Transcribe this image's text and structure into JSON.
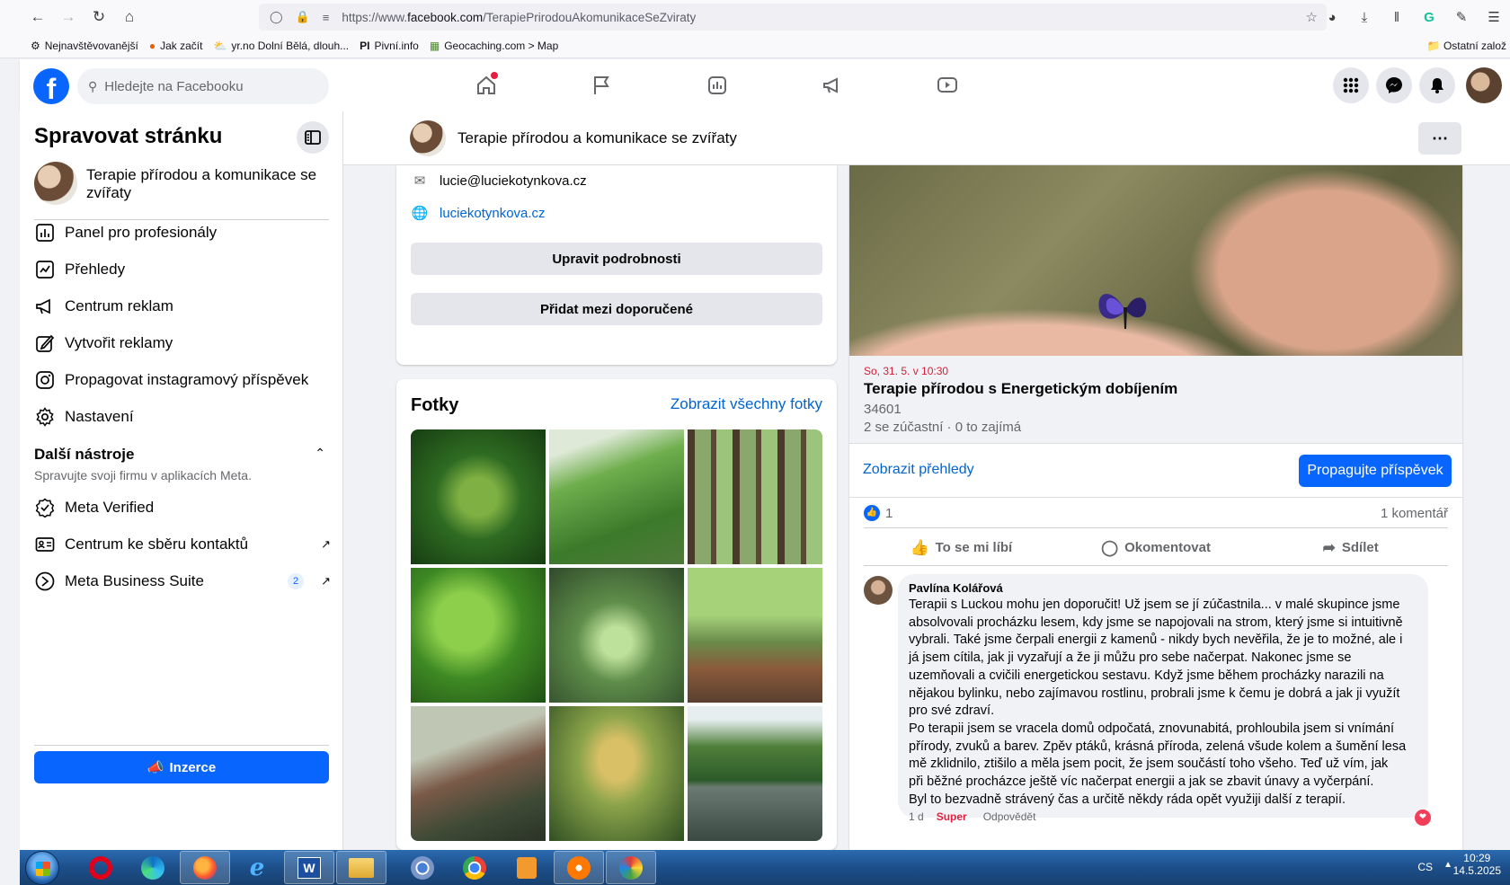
{
  "browser": {
    "url_prefix": "https://www.",
    "url_domain": "facebook.com",
    "url_path": "/TerapiePrirodouAkomunikaceSeZviraty",
    "bookmarks": [
      {
        "label": "Nejnavštěvovanější",
        "icon": "gear-icon"
      },
      {
        "label": "Jak začít",
        "icon": "firefox-icon"
      },
      {
        "label": "yr.no Dolní Bělá, dlouh...",
        "icon": "weather-icon"
      },
      {
        "label": "Pivní.info",
        "icon": "pi-icon"
      },
      {
        "label": "Geocaching.com > Map",
        "icon": "geocaching-icon"
      }
    ],
    "other_bookmarks": "Ostatní založ"
  },
  "fb": {
    "search_placeholder": "Hledejte na Facebooku"
  },
  "sidebar": {
    "title": "Spravovat stránku",
    "page_name": "Terapie přírodou a komunikace se zvířaty",
    "items": [
      {
        "label": "Panel pro profesionály",
        "icon": "dashboard-icon"
      },
      {
        "label": "Přehledy",
        "icon": "insights-icon"
      },
      {
        "label": "Centrum reklam",
        "icon": "megaphone-icon"
      },
      {
        "label": "Vytvořit reklamy",
        "icon": "pencil-icon"
      },
      {
        "label": "Propagovat instagramový příspěvek",
        "icon": "instagram-icon"
      },
      {
        "label": "Nastavení",
        "icon": "gear-icon"
      }
    ],
    "tools_title": "Další nástroje",
    "tools_subtitle": "Spravujte svoji firmu v aplikacích Meta.",
    "tools": [
      {
        "label": "Meta Verified",
        "icon": "verified-icon"
      },
      {
        "label": "Centrum ke sběru kontaktů",
        "icon": "contact-card-icon"
      },
      {
        "label": "Meta Business Suite",
        "icon": "meta-suite-icon",
        "badge": "2"
      }
    ],
    "ad_button": "Inzerce"
  },
  "page_header": {
    "name": "Terapie přírodou a komunikace se zvířaty"
  },
  "info": {
    "email": "lucie@luciekotynkova.cz",
    "website": "luciekotynkova.cz",
    "edit_button": "Upravit podrobnosti",
    "recommend_button": "Přidat mezi doporučené"
  },
  "photos": {
    "title": "Fotky",
    "view_all": "Zobrazit všechny fotky"
  },
  "post": {
    "event_date": "So, 31. 5. v 10:30",
    "event_title": "Terapie přírodou s Energetickým dobíjením",
    "event_location": "34601",
    "event_stats": "2 se zúčastní · 0 to zajímá",
    "insights_link": "Zobrazit přehledy",
    "boost_button": "Propagujte příspěvek",
    "like_count": "1",
    "comment_count": "1 komentář",
    "actions": {
      "like": "To se mi líbí",
      "comment": "Okomentovat",
      "share": "Sdílet"
    },
    "comment": {
      "author": "Pavlína Kolářová",
      "lines": [
        "Terapii s Luckou mohu jen doporučit! Už jsem se jí zúčastnila... v malé skupince jsme",
        "absolvovali procházku lesem, kdy jsme se napojovali na strom, který jsme si intuitivně",
        "vybrali. Také jsme čerpali energii z kamenů - nikdy bych nevěřila, že je to možné, ale i",
        "já jsem cítila, jak ji vyzařují a že ji můžu pro sebe načerpat. Nakonec jsme se",
        "uzemňovali a cvičili energetickou sestavu. Když jsme během procházky narazili na",
        "nějakou bylinku, nebo zajímavou rostlinu, probrali jsme k čemu je dobrá a jak ji využít",
        "pro své zdraví.",
        "Po terapii jsem se vracela domů odpočatá, znovunabitá, prohloubila jsem si vnímání",
        "přírody, zvuků a barev. Zpěv ptáků, krásná příroda, zelená všude kolem a šumění lesa",
        "mě zklidnilo, ztišilo a měla jsem pocit, že jsem součástí toho všeho. Teď už vím, jak",
        "při běžné procházce ještě víc načerpat energii a jak se zbavit únavy a vyčerpání.",
        "Byl to bezvadně strávený čas a určitě někdy ráda opět využiji další z terapií."
      ],
      "age": "1 d",
      "reaction": "Super",
      "reply": "Odpovědět"
    }
  },
  "taskbar": {
    "lang": "CS",
    "time": "10:29",
    "date": "14.5.2025"
  },
  "colors": {
    "fb_blue": "#0866ff",
    "link_blue": "#0064d1",
    "event_red": "#d01e3a",
    "background": "#f0f2f5"
  }
}
